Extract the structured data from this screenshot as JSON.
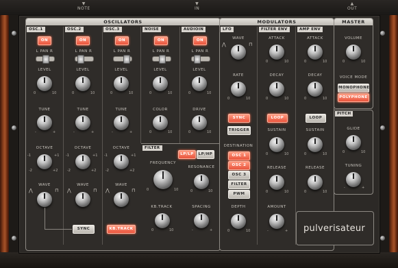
{
  "ports": {
    "note": "NOTE",
    "in": "IN",
    "out": "OUT"
  },
  "sections": {
    "oscillators": "OSCILLATORS",
    "modulators": "MODULATORS",
    "master": "MASTER",
    "filter": "FILTER",
    "pitch": "PITCH"
  },
  "osc_cols": [
    {
      "name": "OSC.1",
      "on": "ON",
      "pan": "PAN",
      "l": "L",
      "r": "R",
      "level": "LEVEL",
      "p2": "TUNE",
      "p3": "OCTAVE",
      "p4": "WAVE"
    },
    {
      "name": "OSC.2",
      "on": "ON",
      "pan": "PAN",
      "l": "L",
      "r": "R",
      "level": "LEVEL",
      "p2": "TUNE",
      "p3": "OCTAVE",
      "p4": "WAVE"
    },
    {
      "name": "OSC.3",
      "on": "ON",
      "pan": "PAN",
      "l": "L",
      "r": "R",
      "level": "LEVEL",
      "p2": "TUNE",
      "p3": "OCTAVE",
      "p4": "WAVE"
    },
    {
      "name": "NOISE",
      "on": "ON",
      "pan": "PAN",
      "l": "L",
      "r": "R",
      "level": "LEVEL",
      "p2": "COLOR"
    },
    {
      "name": "AUDIOIN",
      "on": "ON",
      "pan": "PAN",
      "l": "L",
      "r": "R",
      "level": "LEVEL",
      "p2": "DRIVE"
    }
  ],
  "osc_buttons": {
    "sync": "SYNC",
    "kbtrack": "KB.TRACK"
  },
  "filter": {
    "lplp": "LP/LP",
    "lphp": "LP/HP",
    "frequency": "FREQUENCY",
    "resonance": "RESONANCE",
    "kbtrack": "KB.TRACK",
    "spacing": "SPACING"
  },
  "lfo": {
    "name": "LFO",
    "wave": "WAVE",
    "rate": "RATE",
    "sync": "SYNC",
    "trigger": "TRIGGER",
    "destination": "DESTINATION",
    "dest": [
      "OSC 1",
      "OSC 2",
      "OSC 3",
      "FILTER",
      "PWM"
    ],
    "depth": "DEPTH"
  },
  "filter_env": {
    "name": "FILTER ENV",
    "attack": "ATTACK",
    "decay": "DECAY",
    "loop": "LOOP",
    "sustain": "SUSTAIN",
    "release": "RELEASE",
    "amount": "AMOUNT"
  },
  "amp_env": {
    "name": "AMP ENV",
    "attack": "ATTACK",
    "decay": "DECAY",
    "loop": "LOOP",
    "sustain": "SUSTAIN",
    "release": "RELEASE"
  },
  "master": {
    "volume": "VOLUME",
    "voice_mode": "VOICE MODE",
    "mono": "MONOPHONE",
    "poly": "POLYPHONE"
  },
  "pitch": {
    "glide": "GLIDE",
    "tuning": "TUNING"
  },
  "scale": {
    "zero": "0",
    "ten": "10",
    "minus": "-",
    "plus": "+",
    "m2": "-2",
    "m1": "-1",
    "p1": "+1",
    "p2": "+2"
  },
  "logo": "pulverisateur"
}
